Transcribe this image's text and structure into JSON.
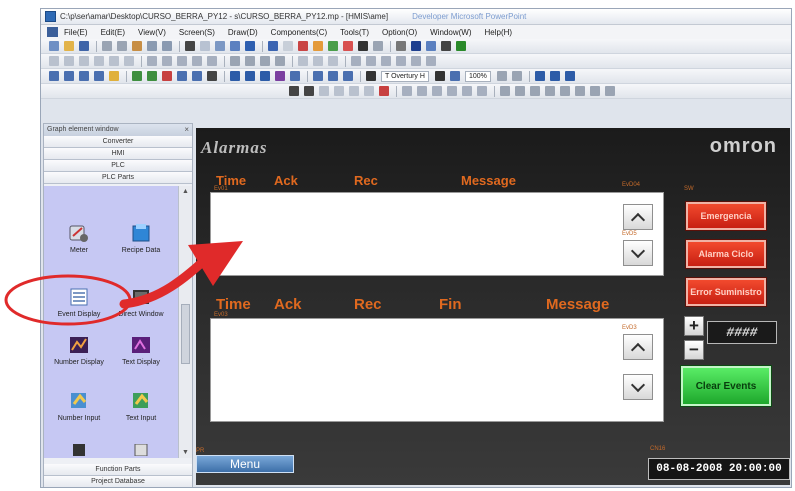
{
  "window": {
    "title": "C:\\p\\ser\\amar\\Desktop\\CURSO_BERRA_PY12 - s\\CURSO_BERRA_PY12.mp - [HMIS\\ame]",
    "title_faded": "Developer  Microsoft PowerPoint"
  },
  "menu": {
    "items": [
      "File(E)",
      "Edit(E)",
      "View(V)",
      "Screen(S)",
      "Draw(D)",
      "Components(C)",
      "Tools(T)",
      "Option(O)",
      "Window(W)",
      "Help(H)"
    ]
  },
  "toolbar": {
    "font_combo": "T Overtury H",
    "zoom_combo": "100%"
  },
  "left_panel": {
    "title": "Graph element window",
    "categories": [
      "Converter",
      "HMI",
      "PLC",
      "PLC Parts"
    ],
    "items": [
      {
        "label": "Meter",
        "icon": "meter-icon"
      },
      {
        "label": "Recipe Data",
        "icon": "recipe-data-icon"
      },
      {
        "label": "Event Display",
        "icon": "event-display-icon"
      },
      {
        "label": "Direct Window",
        "icon": "direct-window-icon"
      },
      {
        "label": "Number Display",
        "icon": "number-display-icon"
      },
      {
        "label": "Text Display",
        "icon": "text-display-icon"
      },
      {
        "label": "Number Input",
        "icon": "number-input-icon"
      },
      {
        "label": "Text Input",
        "icon": "text-input-icon"
      }
    ],
    "bottom_categories": [
      "Function Parts",
      "Project Database"
    ]
  },
  "hmi": {
    "title": "Alarmas",
    "brand": "omron",
    "table1": {
      "col_time": "Time",
      "col_ack": "Ack",
      "col_rec": "Rec",
      "col_message": "Message",
      "tiny_label": "Ev01"
    },
    "table2": {
      "col_time": "Time",
      "col_ack": "Ack",
      "col_rec": "Rec",
      "col_fin": "Fin",
      "col_message": "Message",
      "tiny_label": "Ev03"
    },
    "tiny_up_label": "EvD04",
    "tiny_down_label": "EvD5",
    "tiny_scroll2_label": "EvD3",
    "tiny_side_label": "SW",
    "emergency_button": "Emergencia",
    "alarm_button": "Alarma Ciclo",
    "error_button": "Error Suministro",
    "plus_label": "+",
    "minus_label": "−",
    "value_display": "####",
    "clear_button": "Clear Events",
    "menu_button": "Menu",
    "datetime": "08-08-2008 20:00:00",
    "tiny_bottom_left": "PR",
    "tiny_bottom_right": "CN16"
  },
  "colors": {
    "annotation": "#e02a2a",
    "hmi_header": "#e0691f",
    "panel_bg": "#c6c8f3"
  }
}
